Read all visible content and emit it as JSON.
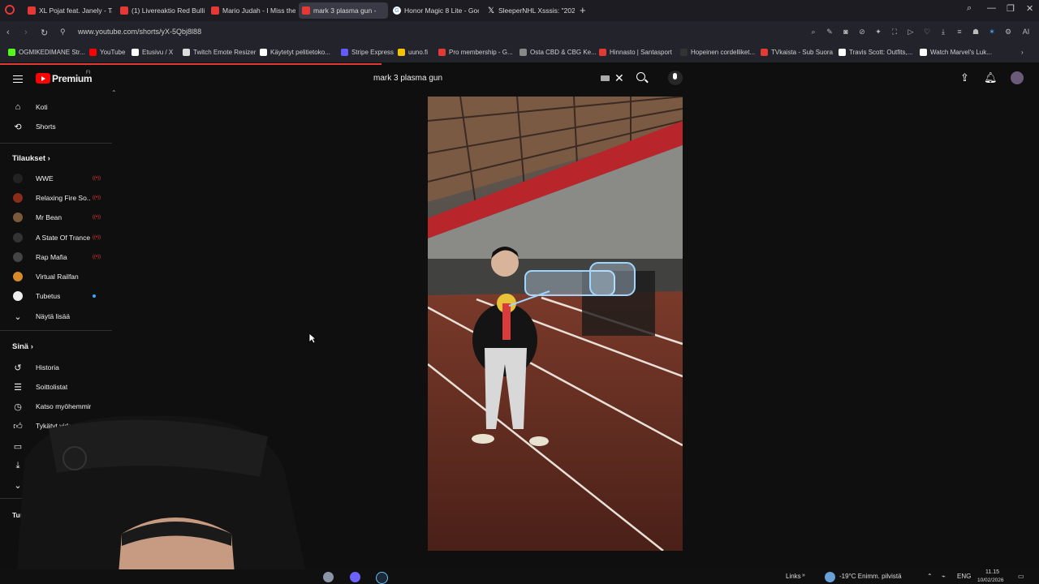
{
  "browser": {
    "tabs": [
      {
        "title": "XL Pojat feat. Janely - Tap...",
        "active": false,
        "fav": "youtube"
      },
      {
        "title": "(1) Livereaktio Red Bullin...",
        "active": false,
        "fav": "youtube"
      },
      {
        "title": "Mario Judah - I Miss the R...",
        "active": false,
        "fav": "youtube"
      },
      {
        "title": "mark 3 plasma gun -",
        "active": true,
        "fav": "youtube"
      },
      {
        "title": "Honor Magic 8 Lite - Goo...",
        "active": false,
        "fav": "google"
      },
      {
        "title": "SleeperNHL Xsssis: \"2026 m...",
        "active": false,
        "fav": "x"
      }
    ],
    "url": "www.youtube.com/shorts/yX-5Qbj8l88",
    "bookmarks": [
      {
        "label": "OGMIKEDIMANE Str...",
        "color": "#53fc18"
      },
      {
        "label": "YouTube",
        "color": "#ff0000"
      },
      {
        "label": "Etusivu / X",
        "color": "#ffffff"
      },
      {
        "label": "Twitch Emote Resizer",
        "color": "#dddddd"
      },
      {
        "label": "Käytetyt pelitietoko...",
        "color": "#ffffff"
      },
      {
        "label": "Stripe Express",
        "color": "#635bff"
      },
      {
        "label": "uuno.fi",
        "color": "#f5c400"
      },
      {
        "label": "Pro membership - G...",
        "color": "#e53935"
      },
      {
        "label": "Osta CBD & CBG Ke...",
        "color": "#888888"
      },
      {
        "label": "Hinnasto | Santasport",
        "color": "#e53935"
      },
      {
        "label": "Hopeinen cordelliket...",
        "color": "#333333"
      },
      {
        "label": "TVkaista - Sub Suora",
        "color": "#e53935"
      },
      {
        "label": "Travis Scott: Outfits,...",
        "color": "#ffffff"
      },
      {
        "label": "Watch Marvel's Luk...",
        "color": "#ffffff"
      }
    ]
  },
  "youtube": {
    "brand": "Premium",
    "region": "FI",
    "search_query": "mark 3 plasma gun",
    "sidebar": {
      "main": [
        {
          "label": "Koti",
          "icon": "home-icon"
        },
        {
          "label": "Shorts",
          "icon": "shorts-icon"
        }
      ],
      "subscriptions_title": "Tilaukset",
      "subscriptions": [
        {
          "label": "WWE",
          "color": "#222222",
          "live": true
        },
        {
          "label": "Relaxing Fire So...",
          "color": "#8b2b1a",
          "live": true
        },
        {
          "label": "Mr Bean",
          "color": "#7a5a3a",
          "live": true
        },
        {
          "label": "A State Of Trance",
          "color": "#333333",
          "live": true
        },
        {
          "label": "Rap Mafia",
          "color": "#444444",
          "live": true
        },
        {
          "label": "Virtual Railfan",
          "color": "#d98a2b",
          "live": false
        },
        {
          "label": "Tubetus",
          "color": "#eeeeee",
          "live": false,
          "dot": true
        }
      ],
      "show_more": "Näytä lisää",
      "you_title": "Sinä",
      "you": [
        {
          "label": "Historia",
          "icon": "history-icon"
        },
        {
          "label": "Soittolistat",
          "icon": "playlist-icon"
        },
        {
          "label": "Katso myöhemmin",
          "icon": "watch-later-icon"
        },
        {
          "label": "Tykätyt videot",
          "icon": "like-icon"
        }
      ],
      "partial_label": "Tur"
    }
  },
  "taskbar": {
    "links": "Links",
    "weather": "-19°C  Enimm. pilvistä",
    "lang": "ENG",
    "time": "11.15",
    "date": "10/02/2026"
  }
}
